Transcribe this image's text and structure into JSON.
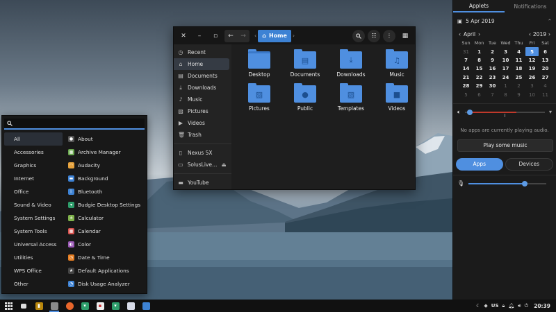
{
  "file_manager": {
    "breadcrumb": "Home",
    "sidebar": [
      {
        "label": "Recent",
        "icon": "clock-icon"
      },
      {
        "label": "Home",
        "icon": "home-icon",
        "active": true
      },
      {
        "label": "Documents",
        "icon": "document-icon"
      },
      {
        "label": "Downloads",
        "icon": "download-icon"
      },
      {
        "label": "Music",
        "icon": "music-icon"
      },
      {
        "label": "Pictures",
        "icon": "picture-icon"
      },
      {
        "label": "Videos",
        "icon": "video-icon"
      },
      {
        "label": "Trash",
        "icon": "trash-icon"
      }
    ],
    "devices": [
      {
        "label": "Nexus 5X",
        "icon": "phone-icon"
      },
      {
        "label": "SolusLive…",
        "icon": "drive-icon"
      }
    ],
    "bookmarks": [
      {
        "label": "YouTube",
        "icon": "folder-icon"
      }
    ],
    "folders": [
      {
        "label": "Desktop",
        "icon": "desktop"
      },
      {
        "label": "Documents",
        "icon": "document"
      },
      {
        "label": "Downloads",
        "icon": "download"
      },
      {
        "label": "Music",
        "icon": "music"
      },
      {
        "label": "Pictures",
        "icon": "picture"
      },
      {
        "label": "Public",
        "icon": "person"
      },
      {
        "label": "Templates",
        "icon": "template"
      },
      {
        "label": "Videos",
        "icon": "video"
      }
    ]
  },
  "raven": {
    "tabs": [
      "Applets",
      "Notifications"
    ],
    "date": "5 Apr 2019",
    "month": "April",
    "year": "2019",
    "weekdays": [
      "Sun",
      "Mon",
      "Tue",
      "Wed",
      "Thu",
      "Fri",
      "Sat"
    ],
    "weeks": [
      [
        "31",
        "1",
        "2",
        "3",
        "4",
        "5",
        "6"
      ],
      [
        "7",
        "8",
        "9",
        "10",
        "11",
        "12",
        "13"
      ],
      [
        "14",
        "15",
        "16",
        "17",
        "18",
        "19",
        "20"
      ],
      [
        "21",
        "22",
        "23",
        "24",
        "25",
        "26",
        "27"
      ],
      [
        "28",
        "29",
        "30",
        "1",
        "2",
        "3",
        "4"
      ],
      [
        "5",
        "6",
        "7",
        "8",
        "9",
        "10",
        "11"
      ]
    ],
    "today": "5",
    "no_audio_text": "No apps are currently playing audio.",
    "play_button": "Play some music",
    "seg_apps": "Apps",
    "seg_devices": "Devices",
    "output_volume": 0.58,
    "mic_volume": 0.72
  },
  "menu": {
    "search_placeholder": "",
    "categories": [
      "All",
      "Accessories",
      "Graphics",
      "Internet",
      "Office",
      "Sound & Video",
      "System Settings",
      "System Tools",
      "Universal Access",
      "Utilities",
      "WPS Office",
      "Other"
    ],
    "apps": [
      {
        "label": "About",
        "icon": "about-icon",
        "color": "#555555"
      },
      {
        "label": "Archive Manager",
        "icon": "archive-icon",
        "color": "#6aa84f"
      },
      {
        "label": "Audacity",
        "icon": "headphones-icon",
        "color": "#e6a23c"
      },
      {
        "label": "Background",
        "icon": "background-icon",
        "color": "#3d82d4"
      },
      {
        "label": "Bluetooth",
        "icon": "bluetooth-icon",
        "color": "#3d82d4"
      },
      {
        "label": "Budgie Desktop Settings",
        "icon": "budgie-icon",
        "color": "#2e9e6b"
      },
      {
        "label": "Calculator",
        "icon": "calculator-icon",
        "color": "#7fb24a"
      },
      {
        "label": "Calendar",
        "icon": "calendar-icon",
        "color": "#d9534f"
      },
      {
        "label": "Color",
        "icon": "color-icon",
        "color": "#9b59b6"
      },
      {
        "label": "Date & Time",
        "icon": "datetime-icon",
        "color": "#e67e22"
      },
      {
        "label": "Default Applications",
        "icon": "star-icon",
        "color": "#444444"
      },
      {
        "label": "Disk Usage Analyzer",
        "icon": "disk-usage-icon",
        "color": "#3d82d4"
      }
    ]
  },
  "panel": {
    "keyboard_layout": "US",
    "clock": "20:39"
  }
}
